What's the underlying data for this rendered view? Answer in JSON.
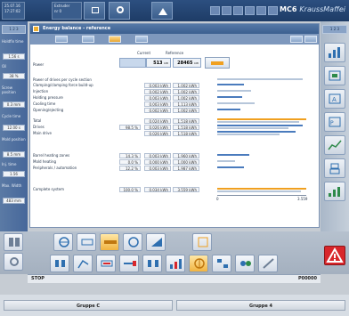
{
  "topbar": {
    "left_box_l1": "25.07.16",
    "left_box_l2": "17:27:02",
    "info_box_l1": "Extruder",
    "info_box_l2": "nr 0",
    "brand_model": "MC6",
    "brand_name": "KraussMaffei"
  },
  "left_sidebar": {
    "top_tab": "1 2 3",
    "fields": [
      {
        "label": "Holdfin time",
        "value": "1.56 s"
      },
      {
        "label": "Oil",
        "value": "38 %"
      },
      {
        "label": "Screw position",
        "value": "0.3 mm"
      },
      {
        "label": "Cycle time",
        "value": "12.00 s"
      },
      {
        "label": "Mold position",
        "value": "8.5 mm"
      },
      {
        "label": "Inj. time",
        "value": "1.56"
      },
      {
        "label": "Max. Width",
        "value": "483 mm"
      }
    ]
  },
  "right_sidebar": {
    "top_tab": "1 2 3"
  },
  "panel": {
    "title": "Energy balance - reference",
    "col_current": "Current",
    "col_reference": "Reference",
    "power_label": "Power",
    "power_current": "513",
    "power_current_unit": "kW",
    "power_reference": "28465",
    "power_reference_unit": "kW",
    "section_label": "Power of drives per cycle section",
    "cycle_rows": [
      {
        "label": "Clamping/clamping force build-up",
        "current": "0.003 kWh",
        "reference": "1.002 kWh"
      },
      {
        "label": "Injection",
        "current": "0.002 kWh",
        "reference": "1.002 kWh"
      },
      {
        "label": "Holding pressure",
        "current": "0.003 kWh",
        "reference": "1.002 kWh"
      },
      {
        "label": "Cooling time",
        "current": "0.003 kWh",
        "reference": "1.113 kWh"
      },
      {
        "label": "Opening/ejecting",
        "current": "0.002 kWh",
        "reference": "1.002 kWh"
      }
    ],
    "drive_rows": [
      {
        "label": "Total",
        "percent": "",
        "current": "0.024 kWh",
        "reference": "1.518 kWh"
      },
      {
        "label": "Drives",
        "percent": "98.5 %",
        "current": "0.026 kWh",
        "reference": "1.518 kWh"
      },
      {
        "label": "Main drive",
        "percent": "",
        "current": "0.026 kWh",
        "reference": "1.518 kWh"
      }
    ],
    "heat_rows": [
      {
        "label": "Barrel heating zones",
        "percent": "14.3 %",
        "current": "0.003 kWh",
        "reference": "1.960 kWh"
      },
      {
        "label": "Mold heating",
        "percent": "0.0 %",
        "current": "0.000 kWh",
        "reference": "1.000 kWh"
      },
      {
        "label": "Peripherals / automation",
        "percent": "12.2 %",
        "current": "0.003 kWh",
        "reference": "1.987 kWh"
      }
    ],
    "complete_label": "Complete system",
    "complete_percent": "100.0 %",
    "complete_current": "0.034 kWh",
    "complete_reference": "3.559 kWh",
    "axis_start": "0",
    "axis_end": "3.559"
  },
  "status": {
    "state": "STOP",
    "code": "P00000"
  },
  "bottom_tabs": {
    "left": "Gruppe C",
    "right": "Gruppe 4"
  }
}
